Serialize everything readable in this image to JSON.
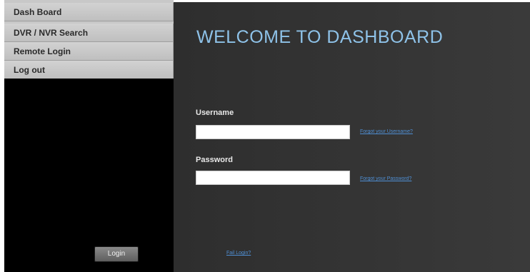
{
  "sidebar": {
    "items": [
      {
        "label": "Dash Board"
      },
      {
        "label": "DVR / NVR Search"
      },
      {
        "label": "Remote Login"
      },
      {
        "label": "Log out"
      }
    ]
  },
  "main": {
    "title": "WELCOME TO DASHBOARD",
    "username_label": "Username",
    "username_value": "",
    "forgot_username_link": "Forgot your Username?",
    "password_label": "Password",
    "password_value": "",
    "forgot_password_link": "Forgot your Password?",
    "login_button": "Login",
    "fail_login_link": "Fail Login?"
  },
  "colors": {
    "title": "#8ec2e8",
    "link": "#4f8fd4",
    "panel_background": "#333333",
    "sidebar_menu": "#c8c8c8"
  }
}
